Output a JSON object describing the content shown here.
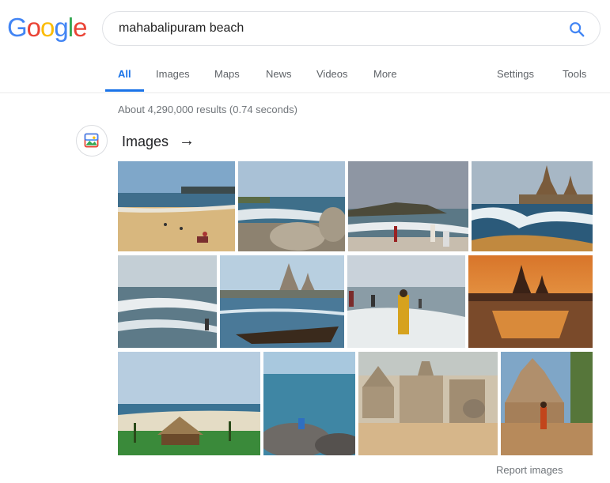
{
  "logo": {
    "letters": [
      "G",
      "o",
      "o",
      "g",
      "l",
      "e"
    ],
    "colors": [
      "#4285F4",
      "#EA4335",
      "#FBBC05",
      "#4285F4",
      "#34A853",
      "#EA4335"
    ]
  },
  "search": {
    "query": "mahabalipuram beach",
    "icon": "search-icon"
  },
  "tabs": [
    {
      "label": "All"
    },
    {
      "label": "Images"
    },
    {
      "label": "Maps"
    },
    {
      "label": "News"
    },
    {
      "label": "Videos"
    },
    {
      "label": "More"
    },
    {
      "label": "Settings"
    },
    {
      "label": "Tools"
    }
  ],
  "stats": "About 4,290,000 results (0.74 seconds)",
  "images_section": {
    "title": "Images",
    "arrow": "→",
    "report": "Report images",
    "thumbnails": [
      {
        "name": "beach-crowd"
      },
      {
        "name": "rocks-shore"
      },
      {
        "name": "waves-people"
      },
      {
        "name": "shore-temple-waves"
      },
      {
        "name": "waves-breaking"
      },
      {
        "name": "temple-boats"
      },
      {
        "name": "people-waves"
      },
      {
        "name": "temple-sunset"
      },
      {
        "name": "beach-resort"
      },
      {
        "name": "sea-rocks"
      },
      {
        "name": "rathas-monuments"
      },
      {
        "name": "ratha-temple"
      }
    ]
  },
  "accent_color": "#1a73e8"
}
